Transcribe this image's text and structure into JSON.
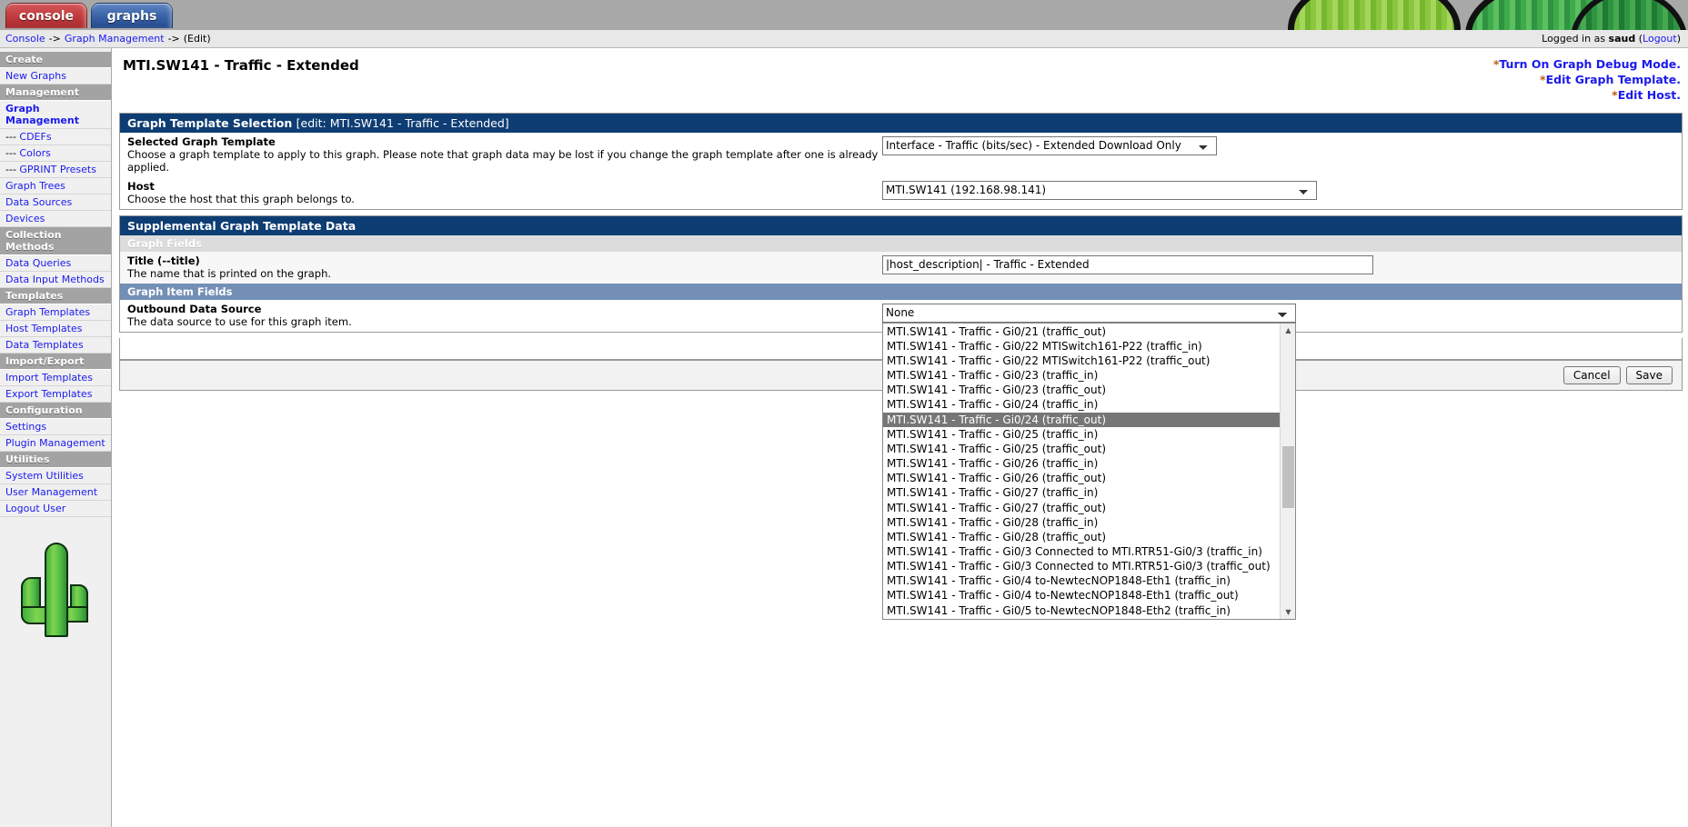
{
  "tabs": [
    {
      "id": "console",
      "label": "console"
    },
    {
      "id": "graphs",
      "label": "graphs"
    }
  ],
  "breadcrumb": {
    "items": [
      "Console",
      "Graph Management",
      "(Edit)"
    ],
    "separator": "->"
  },
  "session": {
    "prefix": "Logged in as",
    "user": "saud",
    "logout_open": "(",
    "logout_label": "Logout",
    "logout_close": ")"
  },
  "sidebar": {
    "sections": [
      {
        "header": "Create",
        "items": [
          {
            "label": "New Graphs",
            "current": false,
            "sub": false
          }
        ]
      },
      {
        "header": "Management",
        "items": [
          {
            "label": "Graph Management",
            "current": true,
            "sub": false
          },
          {
            "label": "CDEFs",
            "current": false,
            "sub": true,
            "dashes": "--- "
          },
          {
            "label": "Colors",
            "current": false,
            "sub": true,
            "dashes": "--- "
          },
          {
            "label": "GPRINT Presets",
            "current": false,
            "sub": true,
            "dashes": "--- "
          },
          {
            "label": "Graph Trees",
            "current": false,
            "sub": false
          },
          {
            "label": "Data Sources",
            "current": false,
            "sub": false
          },
          {
            "label": "Devices",
            "current": false,
            "sub": false
          }
        ]
      },
      {
        "header": "Collection Methods",
        "items": [
          {
            "label": "Data Queries",
            "current": false,
            "sub": false
          },
          {
            "label": "Data Input Methods",
            "current": false,
            "sub": false
          }
        ]
      },
      {
        "header": "Templates",
        "items": [
          {
            "label": "Graph Templates",
            "current": false,
            "sub": false
          },
          {
            "label": "Host Templates",
            "current": false,
            "sub": false
          },
          {
            "label": "Data Templates",
            "current": false,
            "sub": false
          }
        ]
      },
      {
        "header": "Import/Export",
        "items": [
          {
            "label": "Import Templates",
            "current": false,
            "sub": false
          },
          {
            "label": "Export Templates",
            "current": false,
            "sub": false
          }
        ]
      },
      {
        "header": "Configuration",
        "items": [
          {
            "label": "Settings",
            "current": false,
            "sub": false
          },
          {
            "label": "Plugin Management",
            "current": false,
            "sub": false
          }
        ]
      },
      {
        "header": "Utilities",
        "items": [
          {
            "label": "System Utilities",
            "current": false,
            "sub": false
          },
          {
            "label": "User Management",
            "current": false,
            "sub": false
          },
          {
            "label": "Logout User",
            "current": false,
            "sub": false
          }
        ]
      }
    ]
  },
  "page": {
    "title": "MTI.SW141 - Traffic - Extended",
    "actions": [
      {
        "star": "*",
        "label": "Turn On Graph Debug Mode."
      },
      {
        "star": "*",
        "label": "Edit Graph Template."
      },
      {
        "star": "*",
        "label": "Edit Host."
      }
    ]
  },
  "template_selection": {
    "panel_title": "Graph Template Selection",
    "panel_subtitle": "[edit: MTI.SW141 - Traffic - Extended]",
    "fields": [
      {
        "label": "Selected Graph Template",
        "help": "Choose a graph template to apply to this graph. Please note that graph data may be lost if you change the graph template after one is already applied.",
        "value": "Interface - Traffic (bits/sec) - Extended Download Only"
      },
      {
        "label": "Host",
        "help": "Choose the host that this graph belongs to.",
        "value": "MTI.SW141 (192.168.98.141)"
      }
    ]
  },
  "supplemental": {
    "panel_title": "Supplemental Graph Template Data",
    "graph_fields_header": "Graph Fields",
    "title_field": {
      "label": "Title (--title)",
      "help": "The name that is printed on the graph.",
      "value": "|host_description| - Traffic - Extended"
    },
    "graph_item_fields_header": "Graph Item Fields",
    "data_source_field": {
      "label": "Outbound Data Source",
      "help": "The data source to use for this graph item.",
      "value": "None"
    }
  },
  "dropdown": {
    "open": true,
    "selected_index": 6,
    "options": [
      "MTI.SW141 - Traffic - Gi0/21 (traffic_out)",
      "MTI.SW141 - Traffic - Gi0/22 MTISwitch161-P22 (traffic_in)",
      "MTI.SW141 - Traffic - Gi0/22 MTISwitch161-P22 (traffic_out)",
      "MTI.SW141 - Traffic - Gi0/23 (traffic_in)",
      "MTI.SW141 - Traffic - Gi0/23 (traffic_out)",
      "MTI.SW141 - Traffic - Gi0/24 (traffic_in)",
      "MTI.SW141 - Traffic - Gi0/24 (traffic_out)",
      "MTI.SW141 - Traffic - Gi0/25 (traffic_in)",
      "MTI.SW141 - Traffic - Gi0/25 (traffic_out)",
      "MTI.SW141 - Traffic - Gi0/26 (traffic_in)",
      "MTI.SW141 - Traffic - Gi0/26 (traffic_out)",
      "MTI.SW141 - Traffic - Gi0/27 (traffic_in)",
      "MTI.SW141 - Traffic - Gi0/27 (traffic_out)",
      "MTI.SW141 - Traffic - Gi0/28 (traffic_in)",
      "MTI.SW141 - Traffic - Gi0/28 (traffic_out)",
      "MTI.SW141 - Traffic - Gi0/3 Connected to MTI.RTR51-Gi0/3 (traffic_in)",
      "MTI.SW141 - Traffic - Gi0/3 Connected to MTI.RTR51-Gi0/3 (traffic_out)",
      "MTI.SW141 - Traffic - Gi0/4 to-NewtecNOP1848-Eth1 (traffic_in)",
      "MTI.SW141 - Traffic - Gi0/4 to-NewtecNOP1848-Eth1 (traffic_out)",
      "MTI.SW141 - Traffic - Gi0/5 to-NewtecNOP1848-Eth2 (traffic_in)"
    ],
    "scroll_up_icon": "▲",
    "scroll_down_icon": "▼"
  },
  "buttons": {
    "cancel": "Cancel",
    "save": "Save"
  },
  "colors": {
    "panel_header": "#0e3d73",
    "subhead_blue": "#738fb5",
    "link": "#1a1aee",
    "star": "#c05a12",
    "selected_option": "#767676"
  }
}
